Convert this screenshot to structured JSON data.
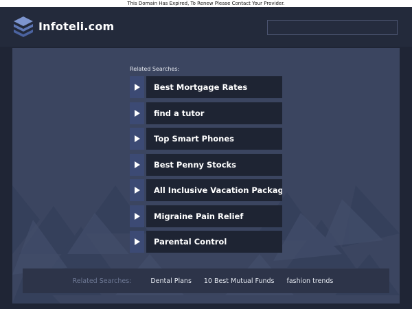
{
  "notice": "This Domain Has Expired, To Renew Please Contact Your Provider.",
  "header": {
    "site_name": "Infoteli.com",
    "logo_icon": "stacked-layers-icon"
  },
  "search": {
    "value": ""
  },
  "related": {
    "label": "Related Searches:",
    "arrow_icon": "play-arrow-icon",
    "items": [
      {
        "label": "Best Mortgage Rates"
      },
      {
        "label": "find a tutor"
      },
      {
        "label": "Top Smart Phones"
      },
      {
        "label": "Best Penny Stocks"
      },
      {
        "label": "All Inclusive Vacation Packages"
      },
      {
        "label": "Migraine Pain Relief"
      },
      {
        "label": "Parental Control"
      }
    ]
  },
  "footer": {
    "label": "Related Searches:",
    "links": [
      "Dental Plans",
      "10 Best Mutual Funds",
      "fashion trends"
    ]
  },
  "colors": {
    "page_bg": "#1f2535",
    "panel_bg": "#3b4560",
    "link_bg": "#1e2433",
    "arrow_bg": "#3c4a74",
    "footer_bg": "#2d3449"
  }
}
